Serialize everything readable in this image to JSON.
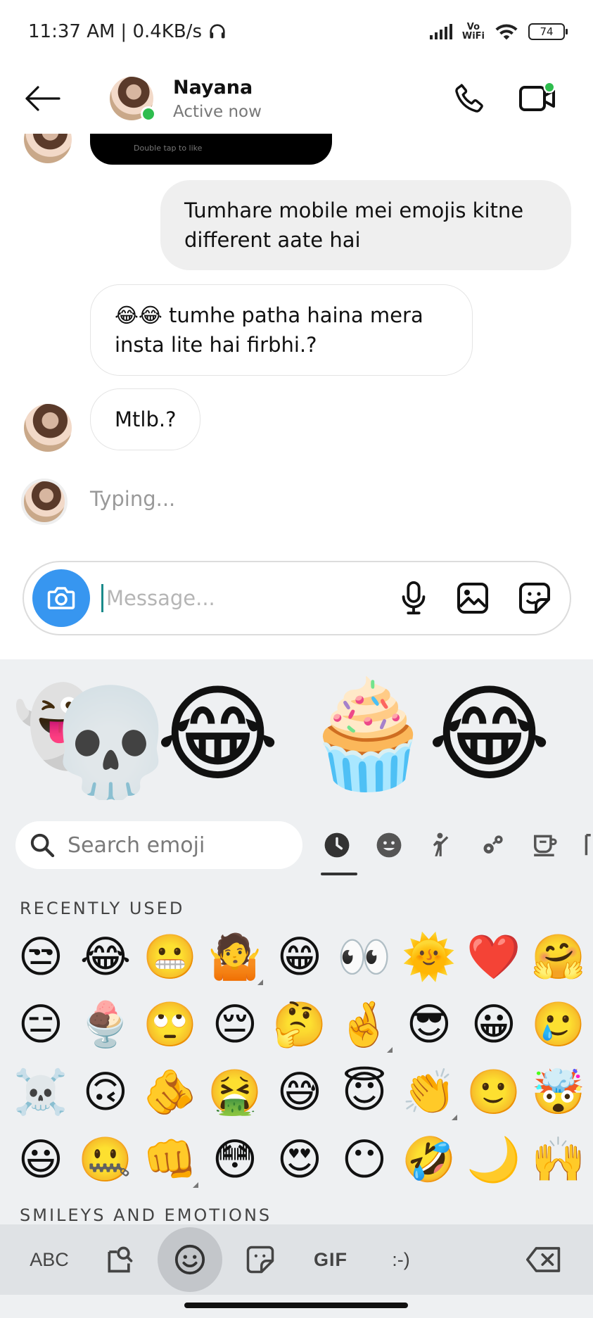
{
  "status_bar": {
    "time": "11:37 AM",
    "speed": "| 0.4KB/s",
    "volte_line1": "Vo",
    "volte_line2": "WiFi",
    "battery": "74"
  },
  "header": {
    "contact_name": "Nayana",
    "contact_status": "Active now"
  },
  "messages": {
    "video_caption": "Double tap to like",
    "outgoing_1": "Tumhare mobile mei emojis kitne different aate hai",
    "incoming_1": "😂😂 tumhe patha haina mera insta lite hai firbhi.?",
    "incoming_2": "Mtlb.?",
    "typing": "Typing..."
  },
  "composer": {
    "placeholder": "Message..."
  },
  "keyboard": {
    "sticker_emojis": [
      "👻",
      "💀",
      "😂",
      "🧁",
      "😂"
    ],
    "search_placeholder": "Search emoji",
    "section_recent": "RECENTLY USED",
    "section_smileys": "SMILEYS AND EMOTIONS",
    "recent_emojis": [
      "😒",
      "😂",
      "😬",
      "🤷",
      "😁",
      "👀",
      "🌞",
      "❤️",
      "🤗",
      "😑",
      "🍨",
      "🙄",
      "😔",
      "🤔",
      "🤞",
      "😎",
      "😀",
      "🥲",
      "☠️",
      "🙃",
      "🫵",
      "🤮",
      "😅",
      "😇",
      "👏",
      "🙂",
      "🤯",
      "😃",
      "🤐",
      "👊",
      "😳",
      "😍",
      "😶",
      "🤣",
      "🌙",
      "🙌"
    ],
    "variant_cells": [
      3,
      14,
      24,
      29,
      38
    ],
    "bottom": {
      "abc": "ABC",
      "gif": "GIF",
      "emoticon": ":-)"
    }
  }
}
